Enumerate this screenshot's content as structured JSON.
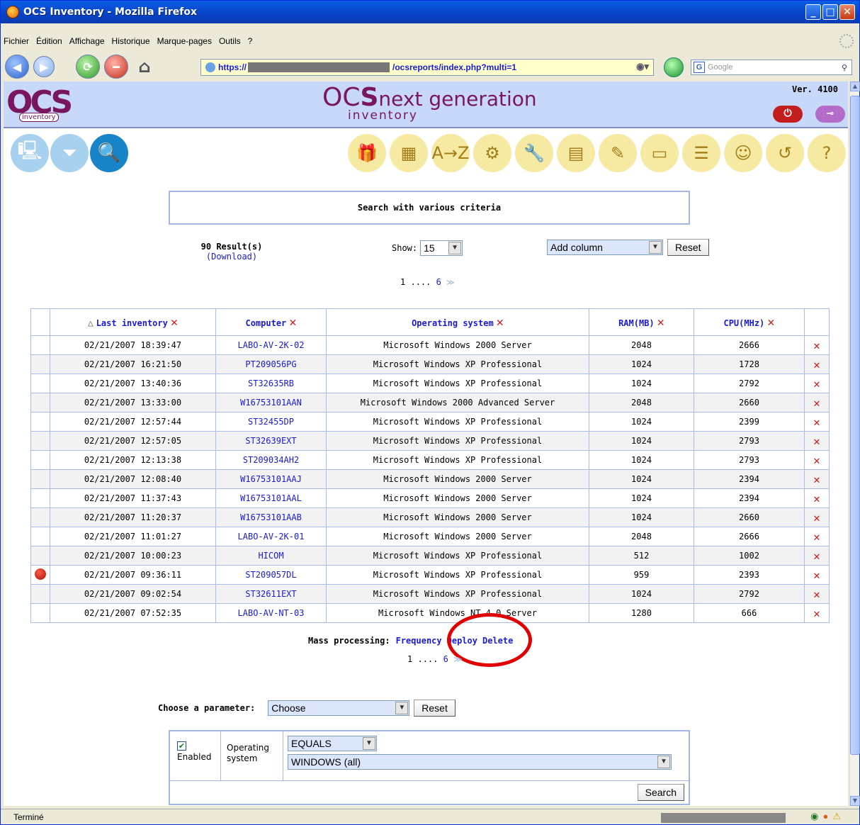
{
  "window": {
    "title": "OCS Inventory - Mozilla Firefox"
  },
  "menu": [
    "Fichier",
    "Édition",
    "Affichage",
    "Historique",
    "Marque-pages",
    "Outils",
    "?"
  ],
  "address": {
    "prefix": "https://",
    "suffix": "/ocsreports/index.php?multi=1"
  },
  "search_box": {
    "placeholder": "Google"
  },
  "banner": {
    "logo": "OCS",
    "logo_sub": "inventory",
    "title": "OCSnext generation",
    "title_sub": "inventory",
    "version": "Ver. 4100"
  },
  "criteria_title": "Search with various criteria",
  "results": {
    "count": "90 Result(s)",
    "download": "(Download)"
  },
  "show": {
    "label": "Show:",
    "value": "15"
  },
  "add_column": {
    "value": "Add column",
    "reset": "Reset"
  },
  "pager": {
    "first": "1",
    "dots": "....",
    "last": "6",
    "next": "≫"
  },
  "table": {
    "headers": [
      "Last inventory",
      "Computer",
      "Operating system",
      "RAM(MB)",
      "CPU(MHz)"
    ],
    "rows": [
      {
        "date": "02/21/2007 18:39:47",
        "computer": "LABO-AV-2K-02",
        "os": "Microsoft Windows 2000 Server",
        "ram": "2048",
        "cpu": "2666"
      },
      {
        "date": "02/21/2007 16:21:50",
        "computer": "PT209056PG",
        "os": "Microsoft Windows XP Professional",
        "ram": "1024",
        "cpu": "1728"
      },
      {
        "date": "02/21/2007 13:40:36",
        "computer": "ST32635RB",
        "os": "Microsoft Windows XP Professional",
        "ram": "1024",
        "cpu": "2792"
      },
      {
        "date": "02/21/2007 13:33:00",
        "computer": "W16753101AAN",
        "os": "Microsoft Windows 2000 Advanced Server",
        "ram": "2048",
        "cpu": "2660"
      },
      {
        "date": "02/21/2007 12:57:44",
        "computer": "ST32455DP",
        "os": "Microsoft Windows XP Professional",
        "ram": "1024",
        "cpu": "2399"
      },
      {
        "date": "02/21/2007 12:57:05",
        "computer": "ST32639EXT",
        "os": "Microsoft Windows XP Professional",
        "ram": "1024",
        "cpu": "2793"
      },
      {
        "date": "02/21/2007 12:13:38",
        "computer": "ST209034AH2",
        "os": "Microsoft Windows XP Professional",
        "ram": "1024",
        "cpu": "2793"
      },
      {
        "date": "02/21/2007 12:08:40",
        "computer": "W16753101AAJ",
        "os": "Microsoft Windows 2000 Server",
        "ram": "1024",
        "cpu": "2394"
      },
      {
        "date": "02/21/2007 11:37:43",
        "computer": "W16753101AAL",
        "os": "Microsoft Windows 2000 Server",
        "ram": "1024",
        "cpu": "2394"
      },
      {
        "date": "02/21/2007 11:20:37",
        "computer": "W16753101AAB",
        "os": "Microsoft Windows 2000 Server",
        "ram": "1024",
        "cpu": "2660"
      },
      {
        "date": "02/21/2007 11:01:27",
        "computer": "LABO-AV-2K-01",
        "os": "Microsoft Windows 2000 Server",
        "ram": "2048",
        "cpu": "2666"
      },
      {
        "date": "02/21/2007 10:00:23",
        "computer": "HICOM",
        "os": "Microsoft Windows XP Professional",
        "ram": "512",
        "cpu": "1002"
      },
      {
        "date": "02/21/2007 09:36:11",
        "computer": "ST209057DL",
        "os": "Microsoft Windows XP Professional",
        "ram": "959",
        "cpu": "2393",
        "flag": true
      },
      {
        "date": "02/21/2007 09:02:54",
        "computer": "ST32611EXT",
        "os": "Microsoft Windows XP Professional",
        "ram": "1024",
        "cpu": "2792"
      },
      {
        "date": "02/21/2007 07:52:35",
        "computer": "LABO-AV-NT-03",
        "os": "Microsoft Windows NT 4.0 Server",
        "ram": "1280",
        "cpu": "666"
      }
    ]
  },
  "mass": {
    "label": "Mass processing:",
    "frequency": "Frequency",
    "deploy": "Deploy",
    "delete": "Delete"
  },
  "param": {
    "label": "Choose a parameter:",
    "value": "Choose",
    "reset": "Reset"
  },
  "criterion": {
    "enabled": "Enabled",
    "field": "Operating system",
    "op": "EQUALS",
    "value": "WINDOWS (all)",
    "search": "Search"
  },
  "status": {
    "text": "Terminé"
  }
}
